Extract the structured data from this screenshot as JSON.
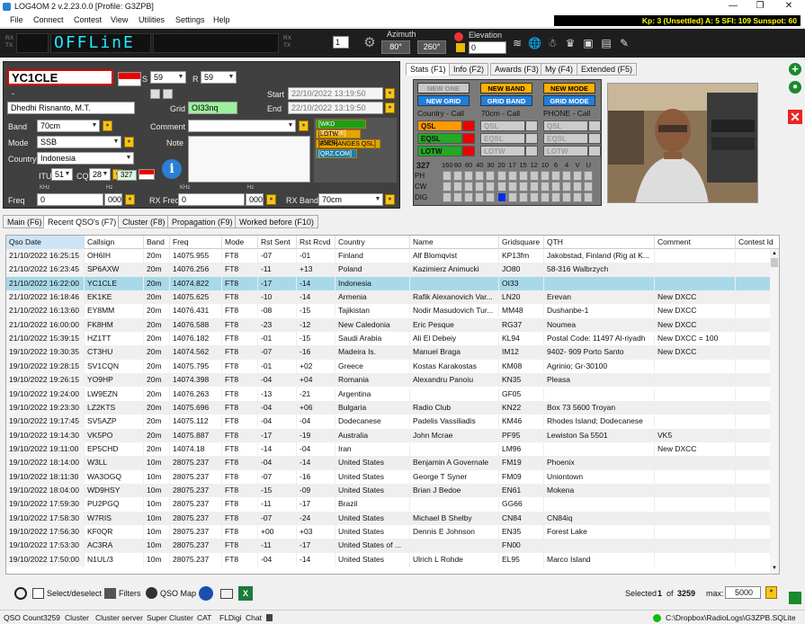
{
  "window": {
    "title": "LOG4OM 2 v.2.23.0.0 [Profile: G3ZPB]"
  },
  "menu": [
    "File",
    "Connect",
    "Contest",
    "View",
    "Utilities",
    "Settings",
    "Help"
  ],
  "kp_bar": "Kp: 3 (Unsettled)  A: 5  SFI: 109 Sunspot: 60",
  "toolbar": {
    "rx": "RX",
    "tx": "TX",
    "led_text": "OFFLinE",
    "radio_number": "1",
    "azimuth_label": "Azimuth",
    "az1": "80°",
    "az2": "260°",
    "elevation_label": "Elevation",
    "elevation_value": "0"
  },
  "entry": {
    "callsign": "YC1CLE",
    "s_label": "S",
    "s_value": "59",
    "r_label": "R",
    "r_value": "59",
    "dash": "-",
    "name": "Dhedhi Risnanto, M.T.",
    "grid_label": "Grid",
    "grid": "OI33nq",
    "start_label": "Start",
    "start": "22/10/2022 13:19:50",
    "end_label": "End",
    "end": "22/10/2022 13:19:50",
    "band_label": "Band",
    "band": "70cm",
    "mode_label": "Mode",
    "mode": "SSB",
    "country_label": "Country",
    "country": "Indonesia",
    "itu_label": "ITU",
    "itu": "51",
    "cq_label": "CQ",
    "cq": "28",
    "dxcc": "327",
    "comment_label": "Comment",
    "note_label": "Note",
    "tags": [
      "[WKD BEFORE]",
      "[LOTW USER]",
      "[EXCHANGES QSL]",
      "[QRZ.COM]"
    ],
    "khz": "KHz",
    "hz": "Hz",
    "freq_label": "Freq",
    "freq_khz": "0",
    "freq_hz": "000",
    "rxfreq_label": "RX Freq",
    "rxfreq_khz": "0",
    "rxfreq_hz": "000",
    "rxband_label": "RX Band",
    "rxband": "70cm"
  },
  "right_tabs": [
    "Stats (F1)",
    "Info (F2)",
    "Awards (F3)",
    "My (F4)",
    "Extended (F5)"
  ],
  "awards": {
    "new_one": "NEW ONE",
    "new_band": "NEW BAND",
    "new_mode": "NEW MODE",
    "new_grid": "NEW GRID",
    "grid_band": "GRID BAND",
    "grid_mode": "GRID MODE"
  },
  "qsl": {
    "col1_title": "Country - Call",
    "col2_title": "70cm - Call",
    "col3_title": "PHONE - Call",
    "qsl": "QSL",
    "eqsl": "EQSL",
    "lotw": "LOTW"
  },
  "bandgrid": {
    "count": "327",
    "bands": [
      "160",
      "80",
      "60",
      "40",
      "30",
      "20",
      "17",
      "15",
      "12",
      "10",
      "6",
      "4",
      "V",
      "U"
    ],
    "rows": [
      "PH",
      "CW",
      "DIG"
    ]
  },
  "lower_tabs": [
    "Main (F6)",
    "Recent QSO's (F7)",
    "Cluster (F8)",
    "Propagation (F9)",
    "Worked before (F10)"
  ],
  "columns": [
    "Qso Date",
    "Callsign",
    "Band",
    "Freq",
    "Mode",
    "Rst Sent",
    "Rst Rcvd",
    "Country",
    "Name",
    "Gridsquare",
    "QTH",
    "Comment",
    "Contest Id"
  ],
  "rows": [
    [
      "21/10/2022 16:25:15",
      "OH6IH",
      "20m",
      "14075.955",
      "FT8",
      "-07",
      "-01",
      "Finland",
      "Alf Blomqvist",
      "KP13fm",
      "Jakobstad, Finland (Rig at K...",
      ""
    ],
    [
      "21/10/2022 16:23:45",
      "SP6AXW",
      "20m",
      "14076.256",
      "FT8",
      "-11",
      "+13",
      "Poland",
      "Kazimierz Animucki",
      "JO80",
      "58-316 Walbrzych",
      ""
    ],
    [
      "21/10/2022 16:22:00",
      "YC1CLE",
      "20m",
      "14074.822",
      "FT8",
      "-17",
      "-14",
      "Indonesia",
      "",
      "OI33",
      "",
      ""
    ],
    [
      "21/10/2022 16:18:46",
      "EK1KE",
      "20m",
      "14075.625",
      "FT8",
      "-10",
      "-14",
      "Armenia",
      "Rafik Alexanovich Var...",
      "LN20",
      "Erevan",
      "New DXCC"
    ],
    [
      "21/10/2022 16:13:60",
      "EY8MM",
      "20m",
      "14076.431",
      "FT8",
      "-08",
      "-15",
      "Tajikistan",
      "Nodir Masudovich Tur...",
      "MM48",
      "Dushanbe-1",
      "New DXCC"
    ],
    [
      "21/10/2022 16:00:00",
      "FK8HM",
      "20m",
      "14076.588",
      "FT8",
      "-23",
      "-12",
      "New Caledonia",
      "Eric Pesque",
      "RG37",
      "Noumea",
      "New DXCC"
    ],
    [
      "21/10/2022 15:39:15",
      "HZ1TT",
      "20m",
      "14076.182",
      "FT8",
      "-01",
      "-15",
      "Saudi Arabia",
      "Ali El Debeiy",
      "KL94",
      "Postal Code: 11497 Al-riyadh",
      "New DXCC = 100"
    ],
    [
      "19/10/2022 19:30:35",
      "CT3HU",
      "20m",
      "14074.562",
      "FT8",
      "-07",
      "-16",
      "Madeira Is.",
      "Manuel Braga",
      "IM12",
      "9402- 909 Porto Santo",
      "New DXCC"
    ],
    [
      "19/10/2022 19:28:15",
      "SV1CQN",
      "20m",
      "14075.795",
      "FT8",
      "-01",
      "+02",
      "Greece",
      "Kostas Karakostas",
      "KM08",
      "Agrinio; Gr-30100",
      ""
    ],
    [
      "19/10/2022 19:26:15",
      "YO9HP",
      "20m",
      "14074.398",
      "FT8",
      "-04",
      "+04",
      "Romania",
      "Alexandru Panoiu",
      "KN35",
      "Pleasa",
      ""
    ],
    [
      "19/10/2022 19:24:00",
      "LW9EZN",
      "20m",
      "14076.263",
      "FT8",
      "-13",
      "-21",
      "Argentina",
      "",
      "GF05",
      "",
      ""
    ],
    [
      "19/10/2022 19:23:30",
      "LZ2KTS",
      "20m",
      "14075.696",
      "FT8",
      "-04",
      "+06",
      "Bulgaria",
      "Radio Club",
      "KN22",
      "Box 73  5600 Troyan",
      ""
    ],
    [
      "19/10/2022 19:17:45",
      "SV5AZP",
      "20m",
      "14075.112",
      "FT8",
      "-04",
      "-04",
      "Dodecanese",
      "Padelis Vassiliadis",
      "KM46",
      "Rhodes Island; Dodecanese",
      ""
    ],
    [
      "19/10/2022 19:14:30",
      "VK5PO",
      "20m",
      "14075.887",
      "FT8",
      "-17",
      "-19",
      "Australia",
      "John Mcrae",
      "PF95",
      "Lewiston Sa 5501",
      "VK5"
    ],
    [
      "19/10/2022 19:11:00",
      "EP5CHD",
      "20m",
      "14074.18",
      "FT8",
      "-14",
      "-04",
      "Iran",
      "",
      "LM96",
      "",
      "New DXCC"
    ],
    [
      "19/10/2022 18:14:00",
      "W3LL",
      "10m",
      "28075.237",
      "FT8",
      "-04",
      "-14",
      "United States",
      "Benjamin A Governale",
      "FM19",
      "Phoenix",
      ""
    ],
    [
      "19/10/2022 18:11:30",
      "WA3OGQ",
      "10m",
      "28075.237",
      "FT8",
      "-07",
      "-16",
      "United States",
      "George T Syner",
      "FM09",
      "Uniontown",
      ""
    ],
    [
      "19/10/2022 18:04:00",
      "WD9HSY",
      "10m",
      "28075.237",
      "FT8",
      "-15",
      "-09",
      "United States",
      "Brian J Bedoe",
      "EN61",
      "Mokena",
      ""
    ],
    [
      "19/10/2022 17:59:30",
      "PU2PGQ",
      "10m",
      "28075.237",
      "FT8",
      "-11",
      "-17",
      "Brazil",
      "",
      "GG66",
      "",
      ""
    ],
    [
      "19/10/2022 17:58:30",
      "W7RIS",
      "10m",
      "28075.237",
      "FT8",
      "-07",
      "-24",
      "United States",
      "Michael B Shelby",
      "CN84",
      "CN84iq",
      ""
    ],
    [
      "19/10/2022 17:56:30",
      "KF0QR",
      "10m",
      "28075.237",
      "FT8",
      "+00",
      "+03",
      "United States",
      "Dennis E Johnson",
      "EN35",
      "Forest Lake",
      ""
    ],
    [
      "19/10/2022 17:53:30",
      "AC3RA",
      "10m",
      "28075.237",
      "FT8",
      "-11",
      "-17",
      "United States of ...",
      "",
      "FN00",
      "",
      ""
    ],
    [
      "19/10/2022 17:50:00",
      "N1UL/3",
      "10m",
      "28075.237",
      "FT8",
      "-04",
      "-14",
      "United States",
      "Ulrich L Rohde",
      "EL95",
      "Marco Island",
      ""
    ]
  ],
  "bottom": {
    "select_label": "Select/deselect",
    "filters_label": "Filters",
    "qsomap_label": "QSO Map",
    "selected_label": "Selected",
    "selected_value": "1",
    "of_label": "of",
    "total": "3259",
    "max_label": "max:",
    "max_value": "5000"
  },
  "status": {
    "qso_count_label": "QSO Count",
    "qso_count": "3259",
    "items": [
      "Cluster",
      "Cluster server",
      "Super Cluster",
      "CAT",
      "FLDigi",
      "Chat"
    ],
    "db_path": "C:\\Dropbox\\RadioLogs\\G3ZPB.SQLite"
  }
}
